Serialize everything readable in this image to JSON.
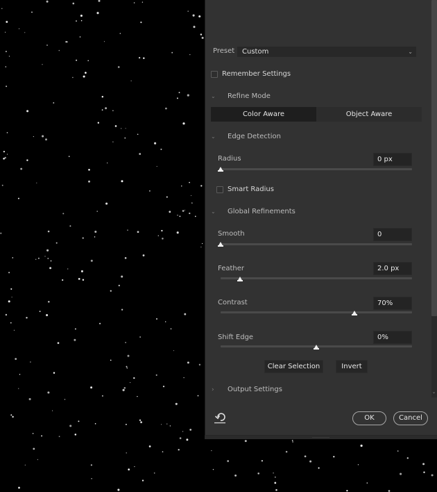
{
  "preset": {
    "label": "Preset",
    "value": "Custom",
    "chevron_icon": "chevron-down-icon"
  },
  "remember_settings": {
    "label": "Remember Settings",
    "checked": false
  },
  "refine_mode": {
    "title": "Refine Mode",
    "expanded": true,
    "options": [
      {
        "label": "Color Aware",
        "active": true
      },
      {
        "label": "Object Aware",
        "active": false
      }
    ]
  },
  "edge_detection": {
    "title": "Edge Detection",
    "expanded": true,
    "radius": {
      "label": "Radius",
      "value": "0 px",
      "slider_fraction": 0.0
    },
    "smart_radius": {
      "label": "Smart Radius",
      "checked": false
    }
  },
  "global_refinements": {
    "title": "Global Refinements",
    "expanded": true,
    "smooth": {
      "label": "Smooth",
      "value": "0",
      "slider_fraction": 0.0
    },
    "feather": {
      "label": "Feather",
      "value": "2.0 px",
      "slider_fraction": 0.1
    },
    "contrast": {
      "label": "Contrast",
      "value": "70%",
      "slider_fraction": 0.7
    },
    "shift_edge": {
      "label": "Shift Edge",
      "value": "0%",
      "slider_fraction": 0.5
    },
    "clear_selection_label": "Clear Selection",
    "invert_label": "Invert"
  },
  "output_settings": {
    "title": "Output Settings",
    "expanded": false
  },
  "footer": {
    "reset_icon": "reset-icon",
    "ok_label": "OK",
    "cancel_label": "Cancel"
  },
  "colors": {
    "panel_bg": "#323232",
    "canvas_bg": "#000000",
    "accent_text": "#e8e8e8"
  }
}
